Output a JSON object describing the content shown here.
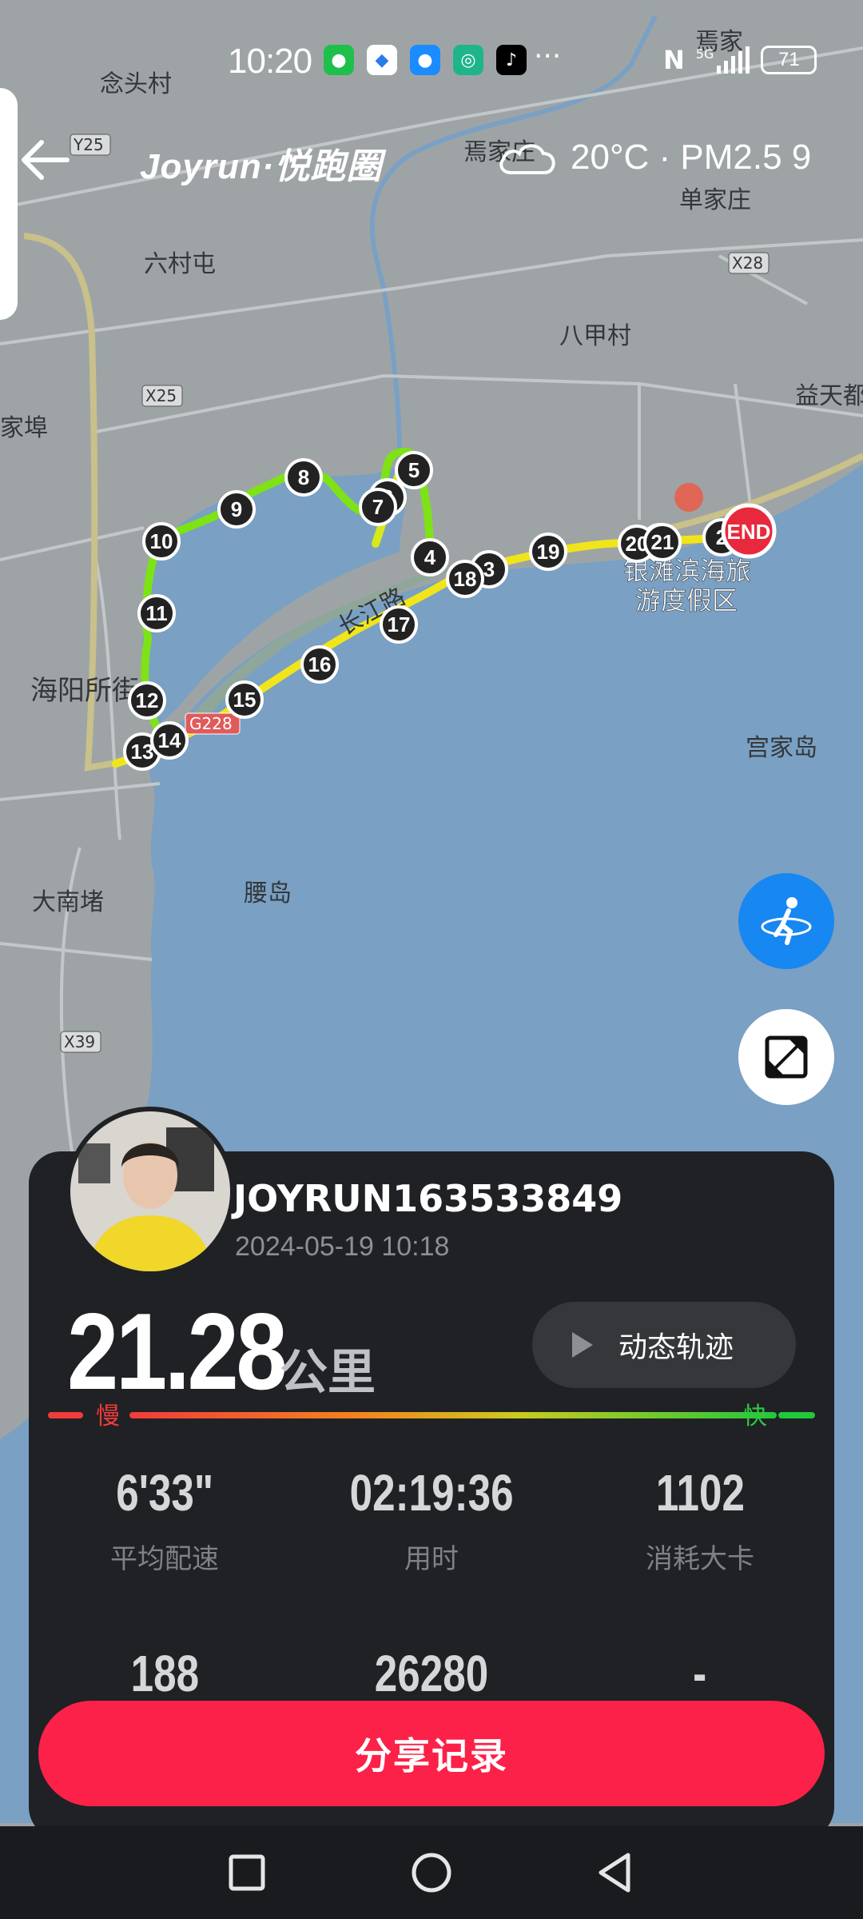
{
  "status_bar": {
    "time": "10:20",
    "battery": "71",
    "network": "5G",
    "app_icons": [
      "wechat-icon",
      "shield-icon",
      "message-icon",
      "mi-icon",
      "tiktok-icon"
    ],
    "more": "···"
  },
  "header": {
    "logo": "Joyrun·悦跑圈",
    "weather": "20°C · PM2.5 9"
  },
  "map": {
    "places": [
      "念头村",
      "焉家庄",
      "焉家",
      "单家庄",
      "六村屯",
      "八甲村",
      "益天都",
      "家埠",
      "海阳所街",
      "银滩滨海旅",
      "游度假区",
      "宫家岛",
      "腰岛",
      "大南堵",
      "长江路"
    ],
    "roads": [
      "Y25",
      "X28",
      "X25",
      "X39",
      "G228"
    ],
    "km_markers": [
      "1",
      "2",
      "3",
      "4",
      "5",
      "6",
      "7",
      "8",
      "9",
      "10",
      "11",
      "12",
      "13",
      "14",
      "15",
      "16",
      "17",
      "18",
      "19",
      "20",
      "21"
    ],
    "end_label": "END"
  },
  "profile": {
    "username": "JOYRUN163533849",
    "datetime": "2024-05-19 10:18"
  },
  "summary": {
    "distance": "21.28",
    "unit": "公里",
    "replay_label": "动态轨迹",
    "slow": "慢",
    "fast": "快"
  },
  "stats": [
    {
      "value": "6'33\"",
      "label": "平均配速"
    },
    {
      "value": "02:19:36",
      "label": "用时"
    },
    {
      "value": "1102",
      "label": "消耗大卡"
    },
    {
      "value": "188",
      "label": ""
    },
    {
      "value": "26280",
      "label": ""
    },
    {
      "value": "-",
      "label": ""
    }
  ],
  "share_label": "分享记录",
  "colors": {
    "accent": "#fc2148",
    "fab_blue": "#1787f1",
    "sea": "#7aa0c4",
    "land": "#9ea4a6",
    "card": "#1f2125"
  }
}
